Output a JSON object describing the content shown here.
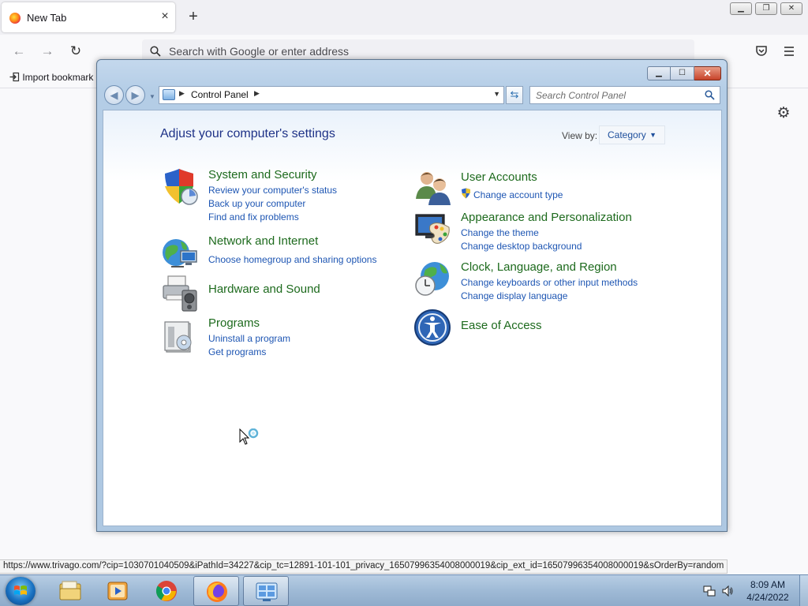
{
  "browser": {
    "tab": {
      "title": "New Tab",
      "close": "×"
    },
    "new_tab": "+",
    "window_controls": {
      "minimize": "▁",
      "restore": "❐",
      "close": "✕"
    },
    "nav": {
      "back": "←",
      "forward": "→",
      "reload": "↻"
    },
    "urlbar": {
      "placeholder": "Search with Google or enter address",
      "value": ""
    },
    "icons": {
      "pocket": "pocket-icon",
      "menu": "hamburger-menu-icon",
      "settings": "gear-icon"
    },
    "bookmarks": {
      "import_label": "Import bookmark"
    },
    "status_url": "https://www.trivago.com/?cip=1030701040509&iPathId=34227&cip_tc=12891-101-101_privacy_16507996354008000019&cip_ext_id=16507996354008000019&sOrderBy=random"
  },
  "control_panel": {
    "window_controls": {
      "minimize": "▁",
      "maximize": "☐",
      "close": "✕"
    },
    "address": {
      "crumb": "Control Panel"
    },
    "search": {
      "placeholder": "Search Control Panel",
      "value": ""
    },
    "heading": "Adjust your computer's settings",
    "view_by": {
      "label": "View by:",
      "selected": "Category"
    },
    "categories_left": [
      {
        "title": "System and Security",
        "icon": "shield-icon",
        "links": [
          "Review your computer's status",
          "Back up your computer",
          "Find and fix problems"
        ]
      },
      {
        "title": "Network and Internet",
        "icon": "network-globe-icon",
        "links": [
          "Choose homegroup and sharing options"
        ]
      },
      {
        "title": "Hardware and Sound",
        "icon": "printer-speaker-icon",
        "links": []
      },
      {
        "title": "Programs",
        "icon": "programs-icon",
        "links": [
          "Uninstall a program",
          "Get programs"
        ]
      }
    ],
    "categories_right": [
      {
        "title": "User Accounts",
        "icon": "users-icon",
        "links": [
          "Change account type"
        ]
      },
      {
        "title": "Appearance and Personalization",
        "icon": "monitor-palette-icon",
        "links": [
          "Change the theme",
          "Change desktop background"
        ]
      },
      {
        "title": "Clock, Language, and Region",
        "icon": "globe-clock-icon",
        "links": [
          "Change keyboards or other input methods",
          "Change display language"
        ]
      },
      {
        "title": "Ease of Access",
        "icon": "ease-of-access-icon",
        "links": []
      }
    ],
    "colors": {
      "title_green": "#1d6a1d",
      "link_blue": "#1e56b3",
      "heading_blue": "#1e3287"
    }
  },
  "taskbar": {
    "apps": [
      "file-explorer-icon",
      "media-player-icon",
      "chrome-icon",
      "firefox-icon",
      "control-panel-icon"
    ],
    "tray": [
      "network-icon",
      "volume-icon"
    ],
    "clock": {
      "time": "8:09 AM",
      "date": "4/24/2022"
    }
  }
}
